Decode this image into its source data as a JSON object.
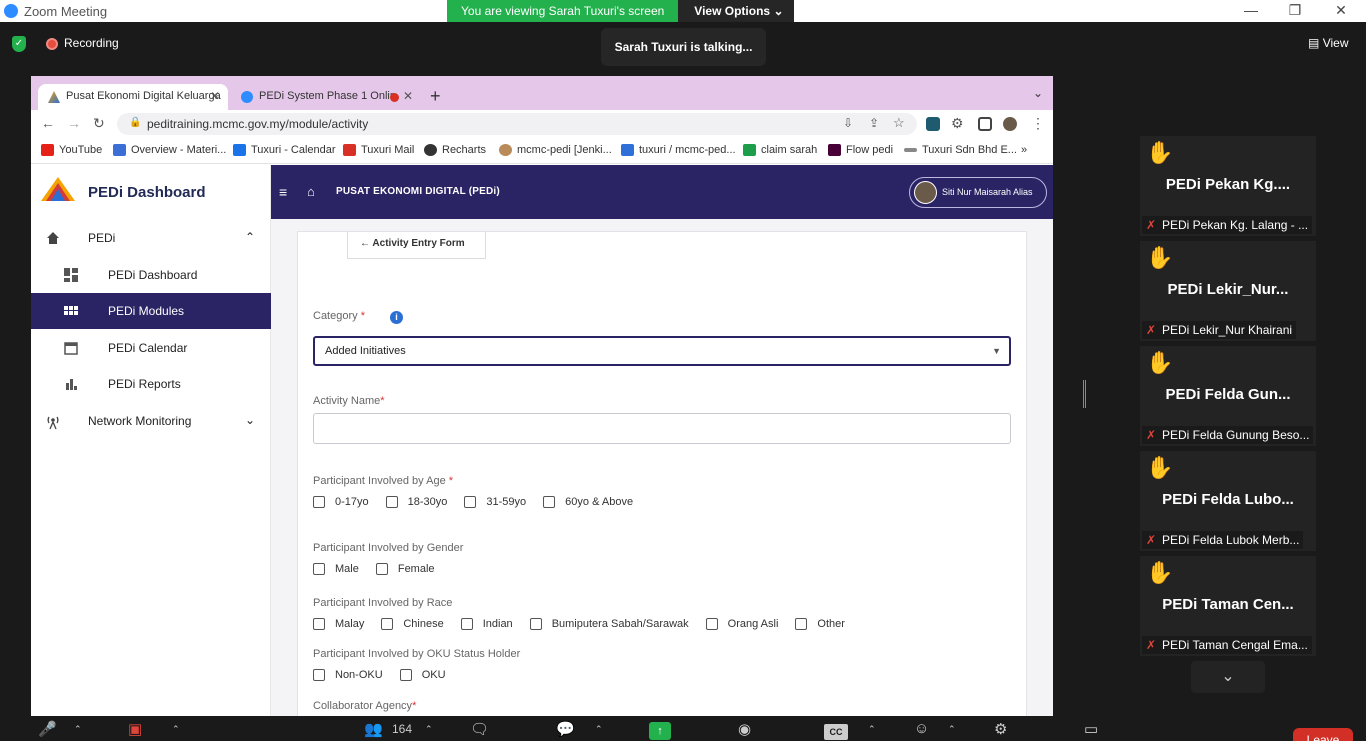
{
  "zoom": {
    "window_title": "Zoom Meeting",
    "share_banner": "You are viewing Sarah Tuxuri's screen",
    "view_options": "View Options",
    "recording_label": "Recording",
    "talking": "Sarah Tuxuri is talking...",
    "view_label": "View",
    "participant_count": "164",
    "leave_label": "Leave",
    "cc_label": "CC"
  },
  "browser": {
    "tabs": [
      {
        "title": "Pusat Ekonomi Digital Keluarga"
      },
      {
        "title": "PEDi System Phase 1 Onlin"
      }
    ],
    "url": "peditraining.mcmc.gov.my/module/activity",
    "bookmarks": [
      {
        "label": "YouTube",
        "color": "#e62117"
      },
      {
        "label": "Overview - Materi...",
        "color": "#3b6fd6"
      },
      {
        "label": "Tuxuri - Calendar",
        "color": "#1a73e8"
      },
      {
        "label": "Tuxuri Mail",
        "color": "#d93025"
      },
      {
        "label": "Recharts",
        "color": "#333333"
      },
      {
        "label": "mcmc-pedi [Jenki...",
        "color": "#b98a5a"
      },
      {
        "label": "tuxuri / mcmc-ped...",
        "color": "#2f6fd8"
      },
      {
        "label": "claim sarah",
        "color": "#1e9e4a"
      },
      {
        "label": "Flow pedi",
        "color": "#470137"
      },
      {
        "label": "Tuxuri Sdn Bhd E...",
        "color": "#888888"
      }
    ]
  },
  "app": {
    "brand": "PEDi Dashboard",
    "header_title": "PUSAT EKONOMI DIGITAL (PEDi)",
    "user_name": "Siti Nur Maisarah Alias",
    "sidebar": {
      "group": "PEDi",
      "items": [
        {
          "label": "PEDi Dashboard"
        },
        {
          "label": "PEDi Modules"
        },
        {
          "label": "PEDi Calendar"
        },
        {
          "label": "PEDi Reports"
        }
      ],
      "network": "Network Monitoring"
    },
    "form": {
      "tab_label": "Activity Entry Form",
      "category_label": "Category",
      "required_mark": "*",
      "category_value": "Added Initiatives",
      "activity_name_label": "Activity Name",
      "age_label": "Participant Involved by Age",
      "age_options": [
        "0-17yo",
        "18-30yo",
        "31-59yo",
        "60yo & Above"
      ],
      "gender_label": "Participant Involved by Gender",
      "gender_options": [
        "Male",
        "Female"
      ],
      "race_label": "Participant Involved by Race",
      "race_options": [
        "Malay",
        "Chinese",
        "Indian",
        "Bumiputera Sabah/Sarawak",
        "Orang Asli",
        "Other"
      ],
      "oku_label": "Participant Involved by OKU Status Holder",
      "oku_options": [
        "Non-OKU",
        "OKU"
      ],
      "collab_label": "Collaborator Agency"
    }
  },
  "participants": [
    {
      "short": "PEDi Pekan Kg....",
      "full": "PEDi Pekan Kg. Lalang - ..."
    },
    {
      "short": "PEDi  Lekir_Nur...",
      "full": "PEDi Lekir_Nur Khairani"
    },
    {
      "short": "PEDi Felda Gun...",
      "full": "PEDi Felda Gunung Beso..."
    },
    {
      "short": "PEDi Felda Lubo...",
      "full": "PEDi Felda Lubok Merb..."
    },
    {
      "short": "PEDi Taman Cen...",
      "full": "PEDi Taman Cengal Ema..."
    }
  ]
}
